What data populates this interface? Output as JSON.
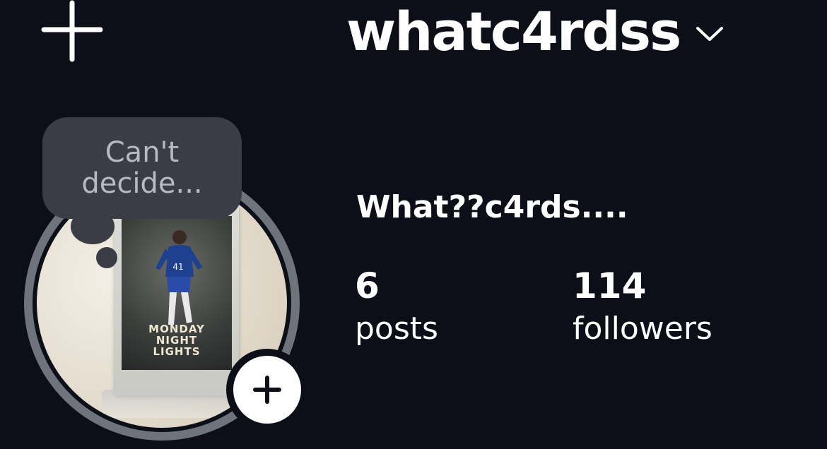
{
  "header": {
    "create_icon": "plus-icon",
    "username": "whatc4rdss",
    "account_switcher_icon": "chevron-down-icon"
  },
  "profile": {
    "note": "Can't\ndecide...",
    "avatar_card_text": [
      "MONDAY",
      "NIGHT",
      "LIGHTS"
    ],
    "add_story_icon": "plus-icon",
    "display_name": "What??c4rds....",
    "stats": {
      "posts_count": "6",
      "posts_label": "posts",
      "followers_count": "114",
      "followers_label": "followers"
    }
  },
  "colors": {
    "background": "#0c0f17",
    "note_bubble": "#3a3d45",
    "note_text": "#b7bac0",
    "avatar_ring": "#6f747c",
    "text": "#ffffff"
  }
}
